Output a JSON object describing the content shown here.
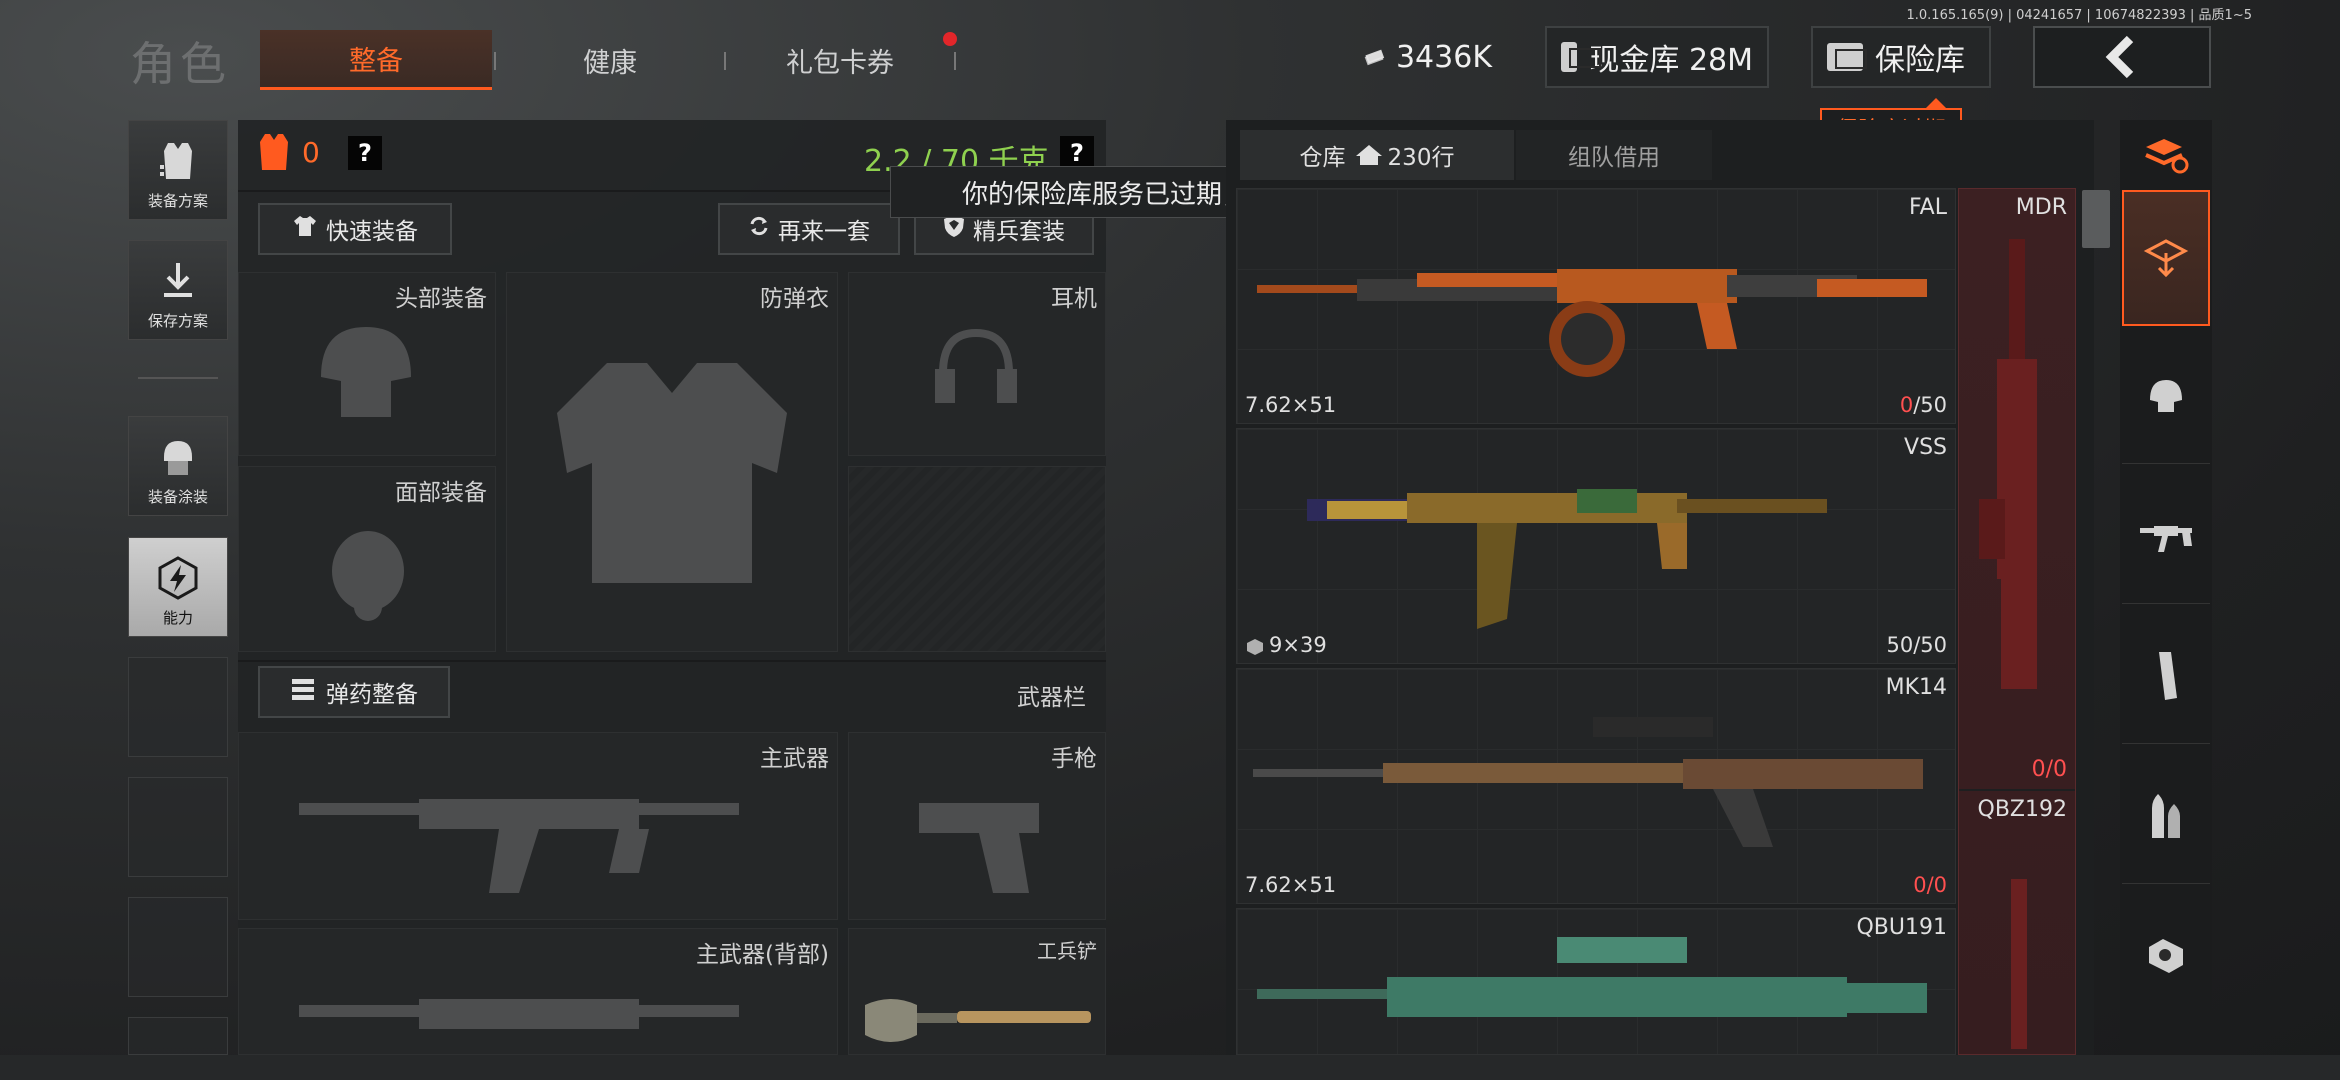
{
  "version_info": "1.0.165.165(9) | 04241657 | 10674822393 | 品质1~5",
  "nav": {
    "title": "角色",
    "tabs": [
      "整备",
      "健康",
      "礼包卡券"
    ]
  },
  "header": {
    "money": "3436K",
    "cash_vault": "现金库 28M",
    "insurance_vault": "保险库",
    "expired_tag": "保险库过期"
  },
  "tooltip": "你的保险库服务已过期，请及时续费",
  "side": {
    "loadout_plan": "装备方案",
    "save_plan": "保存方案",
    "skin": "装备涂装",
    "ability": "能力"
  },
  "equip": {
    "armor_count": "0",
    "help": "?",
    "weight": "2.2 / 70 千克",
    "quick_equip": "快速装备",
    "again": "再来一套",
    "elite": "精兵套装",
    "head": "头部装备",
    "vest": "防弹衣",
    "headset": "耳机",
    "face": "面部装备",
    "ammo_btn": "弹药整备",
    "weapon_bar": "武器栏",
    "primary": "主武器",
    "pistol": "手枪",
    "primary_back": "主武器(背部)",
    "shovel": "工兵铲"
  },
  "warehouse": {
    "tab_storage": "仓库",
    "tab_rows": "230行",
    "tab_team": "组队借用",
    "items": [
      {
        "name": "FAL",
        "caliber": "7.62×51",
        "count_zero": "0",
        "count_total": "/50"
      },
      {
        "name": "VSS",
        "caliber": "9×39",
        "count_full": "50/50"
      },
      {
        "name": "MK14",
        "caliber": "7.62×51",
        "count_zero": "0",
        "count_total_zero": "/0"
      },
      {
        "name": "QBU191"
      }
    ],
    "side_items": [
      {
        "name": "MDR",
        "count": "0/0"
      },
      {
        "name": "QBZ192"
      }
    ]
  },
  "colors": {
    "accent": "#ff5a1f",
    "weight_green": "#8fd14f",
    "zero_red": "#ff5050"
  }
}
